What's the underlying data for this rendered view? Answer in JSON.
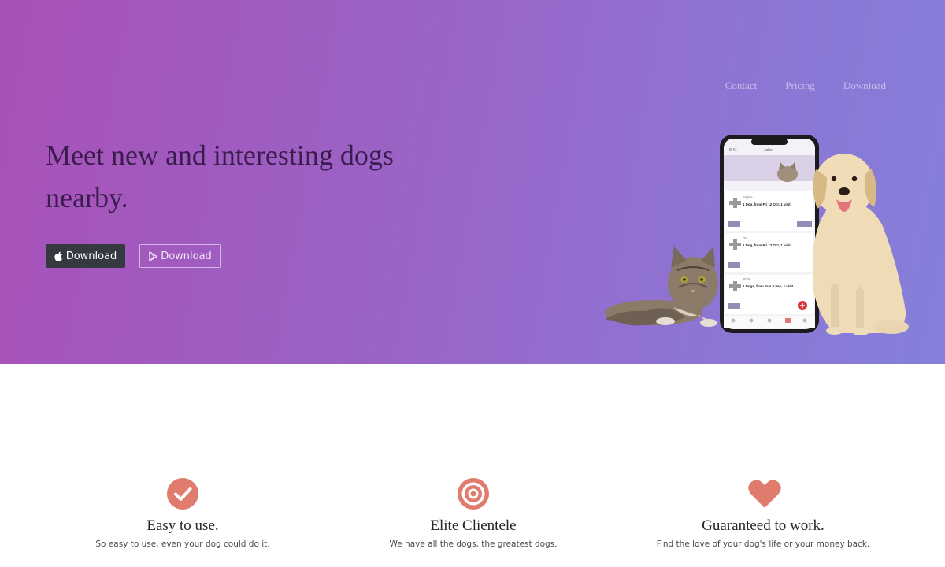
{
  "nav": {
    "items": [
      {
        "label": "Contact"
      },
      {
        "label": "Pricing"
      },
      {
        "label": "Download"
      }
    ]
  },
  "hero": {
    "headline": "Meet new and interesting dogs nearby.",
    "buttons": {
      "apple_download": "Download",
      "play_download": "Download"
    }
  },
  "phone": {
    "status_time": "9:41",
    "header_title": "Jobs",
    "cards": [
      {
        "name": "Inspire",
        "line": "1 Dog, from Fri 12 Oct, 1 visit"
      },
      {
        "name": "Ox",
        "line": "1 Dog, from Fri 12 Oct, 1 visit"
      },
      {
        "name": "Rock",
        "line": "1 Dogs, from Sun 9 Sep, 1 visit"
      }
    ]
  },
  "features": [
    {
      "icon": "check-circle-icon",
      "title": "Easy to use.",
      "text": "So easy to use, even your dog could do it."
    },
    {
      "icon": "target-icon",
      "title": "Elite Clientele",
      "text": "We have all the dogs, the greatest dogs."
    },
    {
      "icon": "heart-icon",
      "title": "Guaranteed to work.",
      "text": "Find the love of your dog's life or your money back."
    }
  ],
  "colors": {
    "hero_gradient_start": "#a851b8",
    "hero_gradient_end": "#8480da",
    "headline": "#3b1d4d",
    "feature_icon": "#e07c6e",
    "dark_button": "#343a40"
  }
}
